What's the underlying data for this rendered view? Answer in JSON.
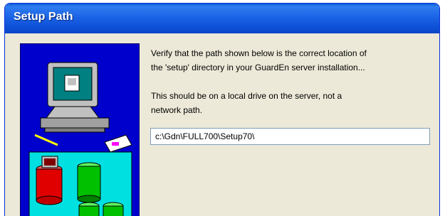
{
  "window": {
    "title": "Setup Path"
  },
  "content": {
    "instruction_line1": "Verify that the path shown below is the correct location of",
    "instruction_line2": "the 'setup' directory in your GuardEn server installation...",
    "note_line1": "This should be on a local drive on the server, not a",
    "note_line2": "network path."
  },
  "path_field": {
    "value": "c:\\Gdn\\FULL700\\Setup70\\"
  },
  "colors": {
    "titlebar": "#0a47c8",
    "dialog_bg": "#ece9d8",
    "art_bg": "#0000cc"
  },
  "icons": [
    "computer-icon",
    "database-cylinders-icon",
    "pencil-icon",
    "card-icon"
  ]
}
